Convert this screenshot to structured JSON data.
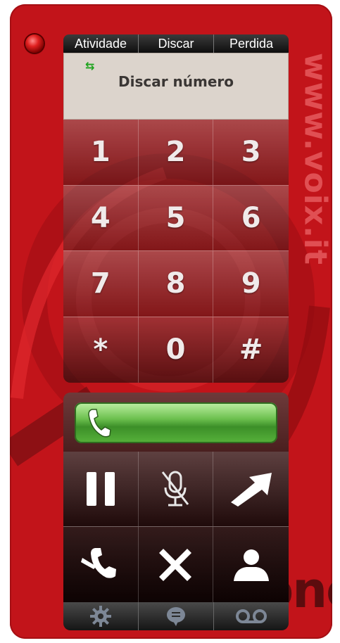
{
  "brand": {
    "vertical_text": "www.voix.it",
    "watermark": "Phone"
  },
  "tabs": [
    {
      "label": "Atividade"
    },
    {
      "label": "Discar"
    },
    {
      "label": "Perdida"
    }
  ],
  "display": {
    "connection_icon": "transfer-arrows-icon",
    "title": "Discar número"
  },
  "keypad": {
    "keys": [
      "1",
      "2",
      "3",
      "4",
      "5",
      "6",
      "7",
      "8",
      "9",
      "*",
      "0",
      "#"
    ]
  },
  "call": {
    "icon": "phone-handset-icon"
  },
  "actions": [
    {
      "icon": "pause-icon"
    },
    {
      "icon": "mute-mic-icon"
    },
    {
      "icon": "transfer-arrow-icon"
    },
    {
      "icon": "hangup-handset-icon"
    },
    {
      "icon": "close-x-icon"
    },
    {
      "icon": "contact-person-icon"
    }
  ],
  "bottom_bar": [
    {
      "icon": "gear-icon"
    },
    {
      "icon": "chat-bubble-icon"
    },
    {
      "icon": "voicemail-icon"
    }
  ],
  "colors": {
    "body_red": "#c2141a",
    "call_green": "#57b23b",
    "display_bg": "#dcd4cc",
    "led_red": "#e02020"
  }
}
